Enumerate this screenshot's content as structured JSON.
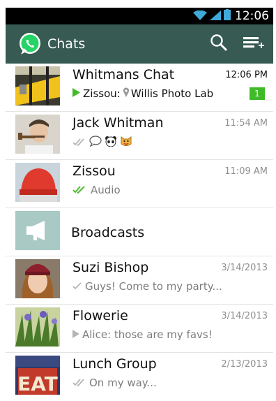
{
  "status_bar": {
    "time": "12:06"
  },
  "app_bar": {
    "title": "Chats",
    "search_icon": "search-icon",
    "new_chat_icon": "new-chat-icon"
  },
  "chats": [
    {
      "name": "Whitmans Chat",
      "time": "12:06 PM",
      "sender": "Zissou:",
      "message": "Willis Photo Lab",
      "unread": "1",
      "status_icon": "play-icon"
    },
    {
      "name": "Jack Whitman",
      "time": "11:54 AM",
      "message": "",
      "status_icon": "double-check-gray-icon",
      "emoji": [
        "speech-bubble-icon",
        "panda-icon",
        "cat-icon"
      ]
    },
    {
      "name": "Zissou",
      "time": "11:09 AM",
      "message": "Audio",
      "status_icon": "double-check-green-icon"
    },
    {
      "name": "Broadcasts",
      "status_icon": "megaphone-icon"
    },
    {
      "name": "Suzi Bishop",
      "time": "3/14/2013",
      "message": "Guys! Come to my party...",
      "status_icon": "check-gray-icon"
    },
    {
      "name": "Flowerie",
      "time": "3/14/2013",
      "message": "Alice: those are my favs!",
      "status_icon": "play-gray-icon"
    },
    {
      "name": "Lunch Group",
      "time": "2/13/2013",
      "message": "On my way...",
      "status_icon": "double-check-gray-icon",
      "avatar_text": "EAT"
    }
  ],
  "colors": {
    "app_bar": "#375a52",
    "accent_green": "#3fbb28",
    "whatsapp_green": "#25d366"
  }
}
